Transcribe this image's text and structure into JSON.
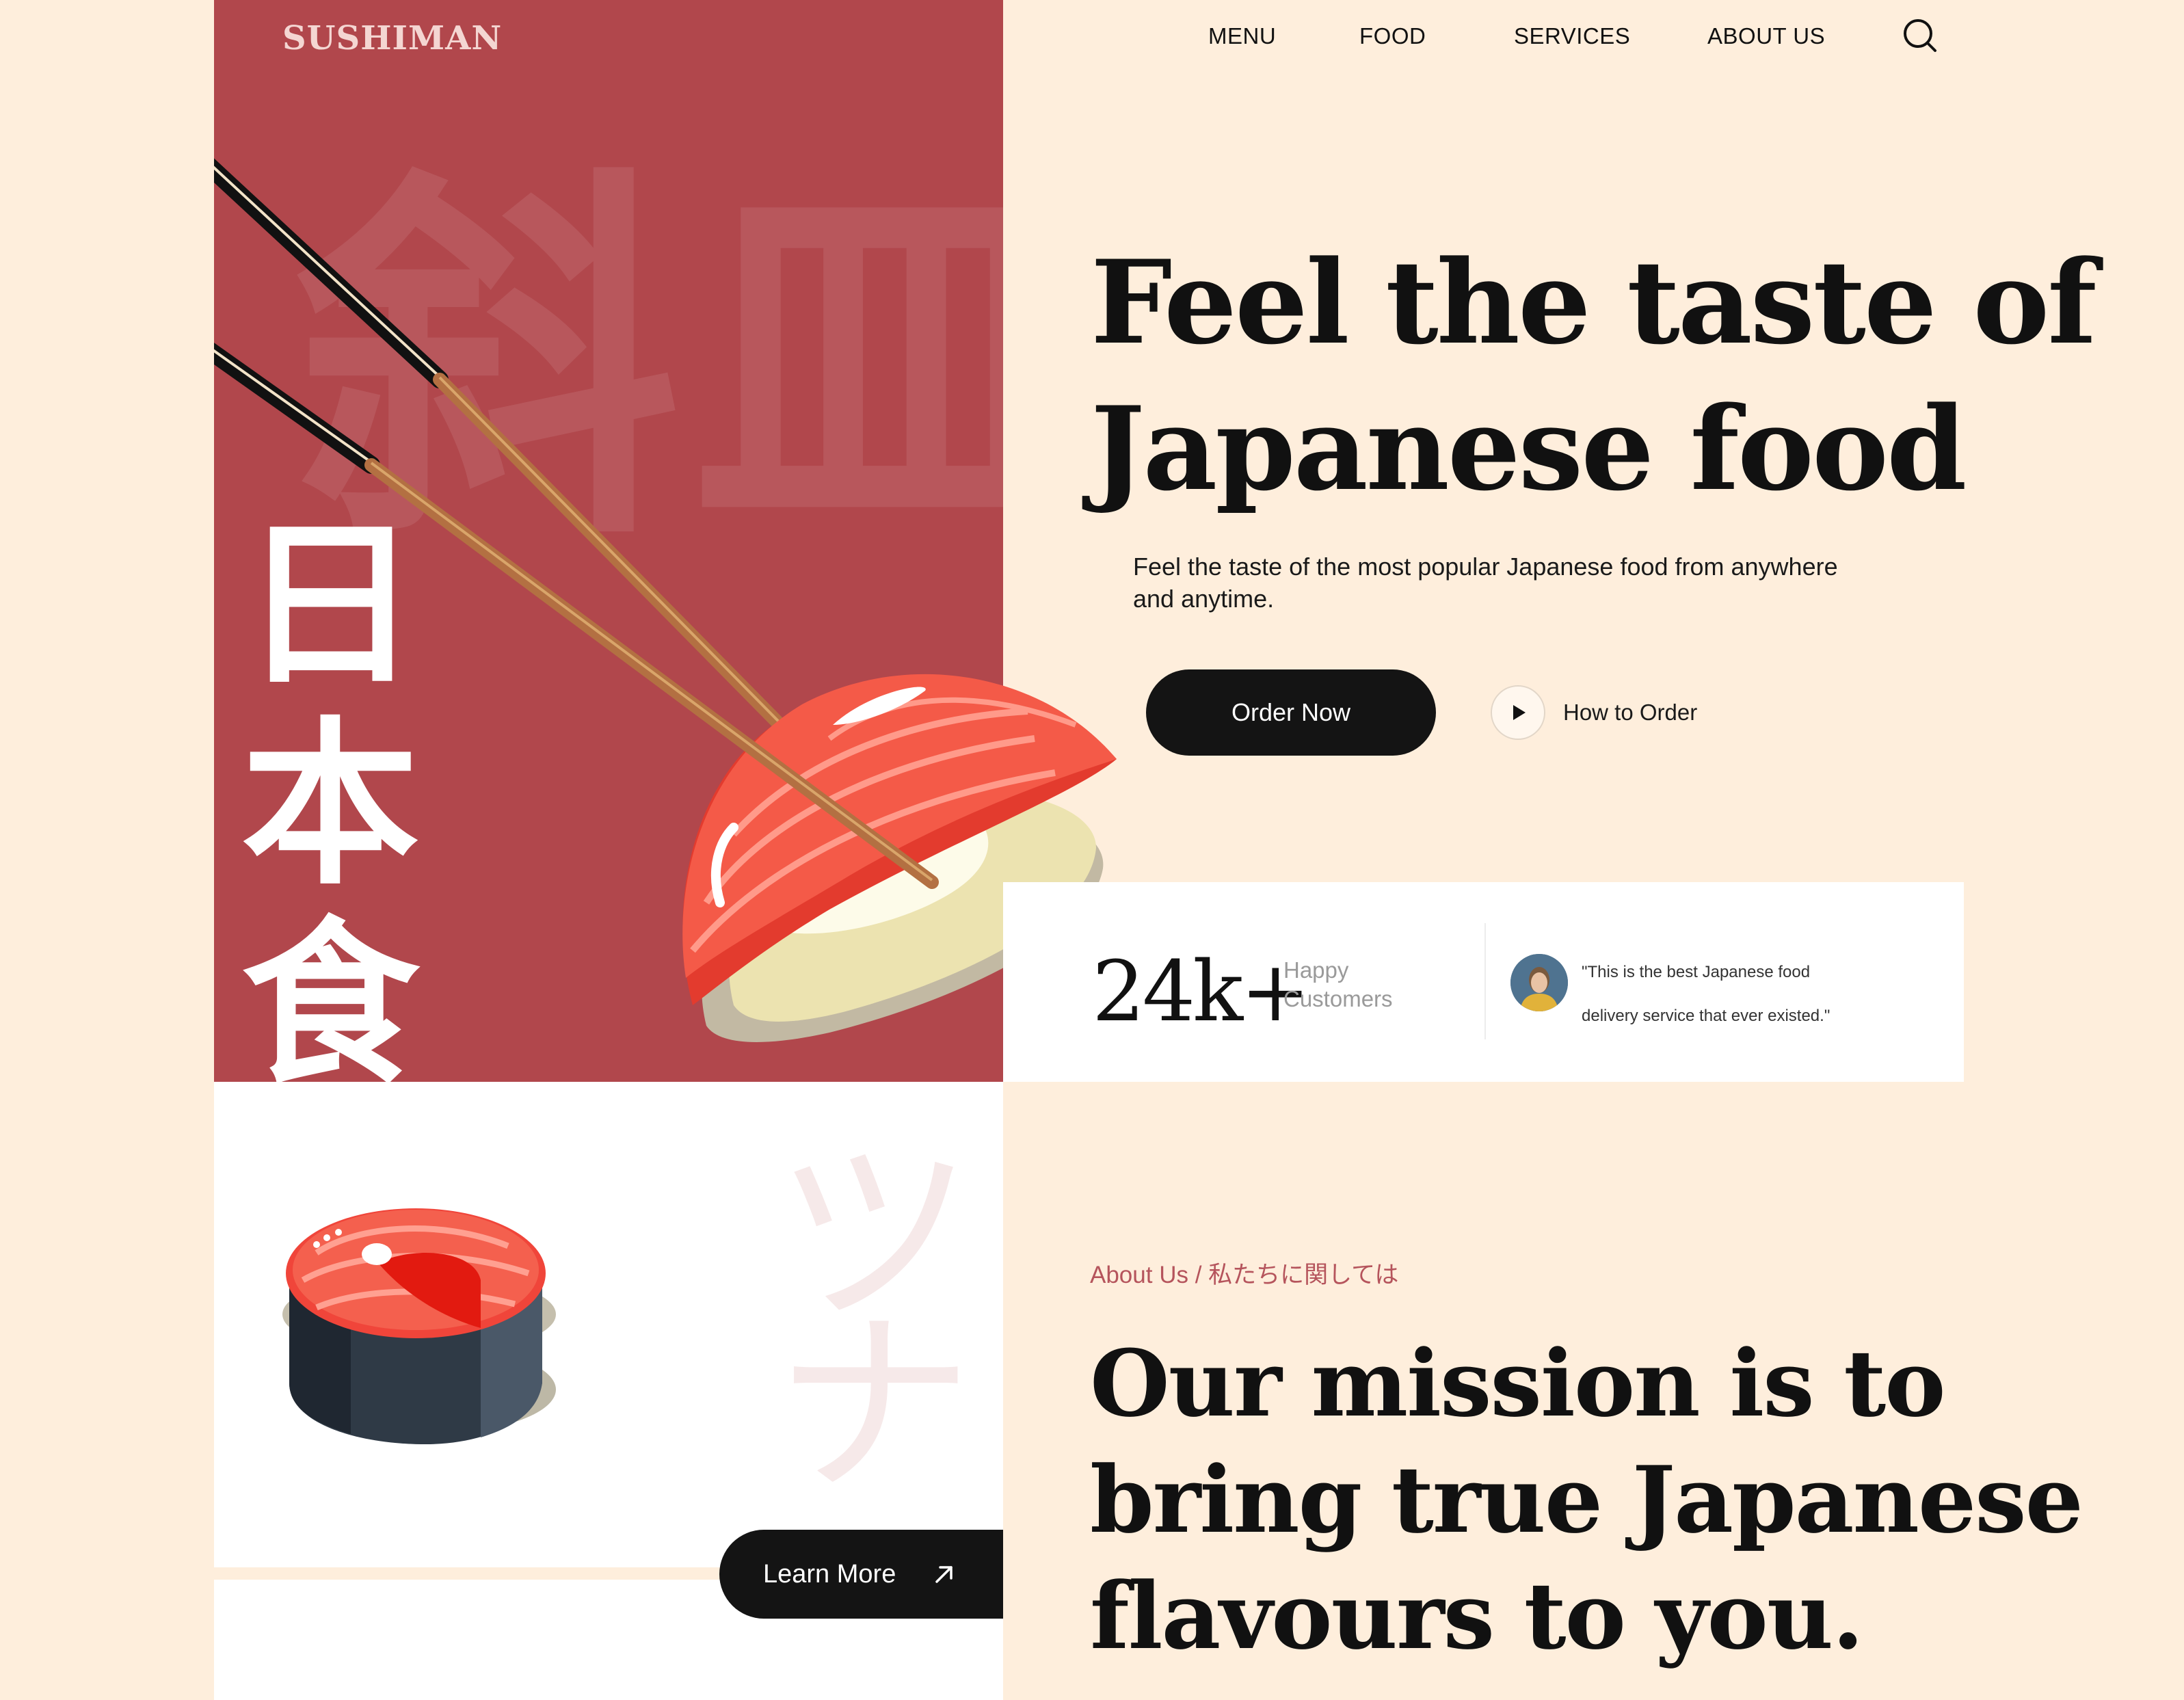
{
  "brand": {
    "logo_text": "SUSHIMAN"
  },
  "nav": {
    "items": [
      {
        "label": "MENU"
      },
      {
        "label": "FOOD"
      },
      {
        "label": "SERVICES"
      },
      {
        "label": "ABOUT US"
      }
    ],
    "search_icon": "search-icon"
  },
  "hero": {
    "title_line1": "Feel the taste of",
    "title_line2": "Japanese food",
    "subtitle": "Feel the taste of the most popular Japanese food from anywhere and anytime.",
    "order_button": "Order Now",
    "how_to_order": "How to Order",
    "vertical_kanji": [
      "日",
      "本",
      "食"
    ],
    "background_kanji": [
      "斜",
      "皿"
    ]
  },
  "stats": {
    "number": "24k+",
    "label_line1": "Happy",
    "label_line2": "Customers",
    "quote_line1": "\"This is the best Japanese food",
    "quote_line2": "delivery service that ever existed.\""
  },
  "about": {
    "tag": "About Us / 私たちに関しては",
    "title_line1": "Our mission is to",
    "title_line2": "bring true Japanese",
    "title_line3": "flavours to you.",
    "learn_more": "Learn More",
    "background_kana": [
      "ツ",
      "ナ"
    ]
  },
  "colors": {
    "background": "#feeedc",
    "brand_red": "#b1474c",
    "dark": "#141414",
    "accent_text": "#b5545c"
  }
}
